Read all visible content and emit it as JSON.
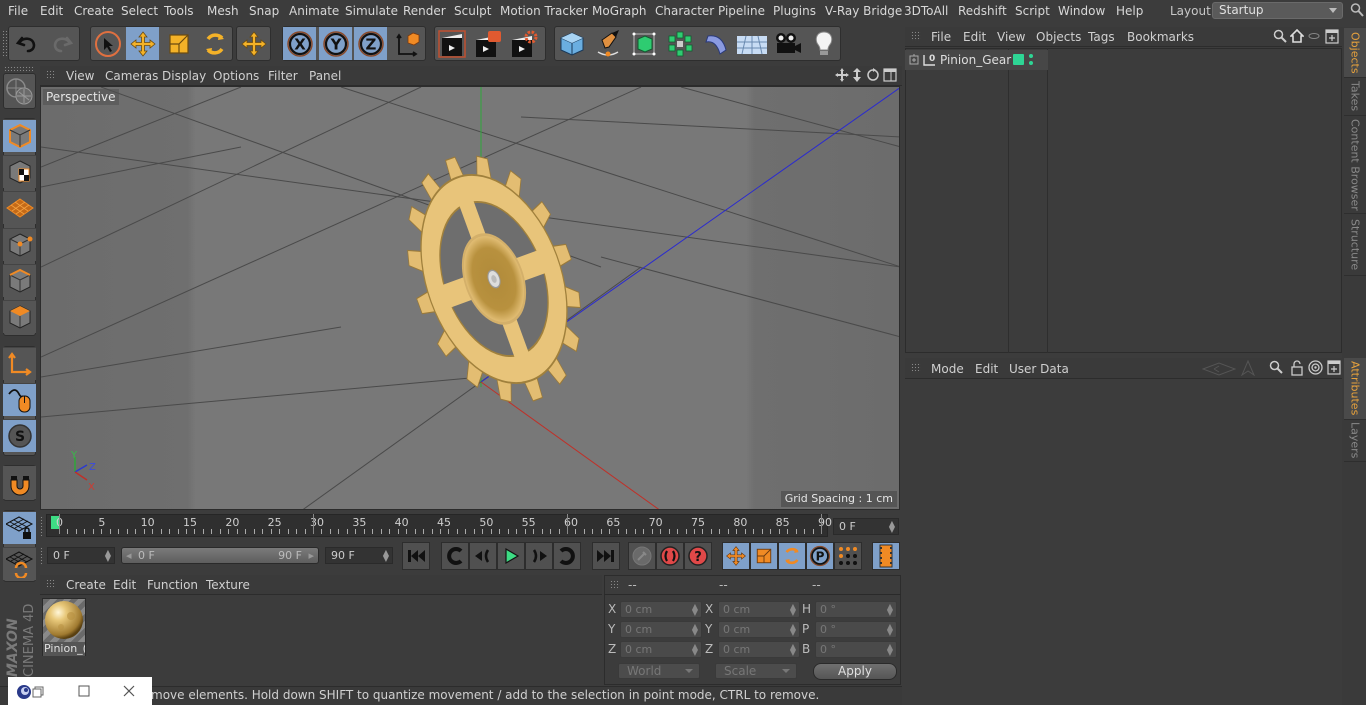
{
  "menubar": {
    "items": [
      "File",
      "Edit",
      "Create",
      "Select",
      "Tools",
      "Mesh",
      "Snap",
      "Animate",
      "Simulate",
      "Render",
      "Sculpt",
      "Motion Tracker",
      "MoGraph",
      "Character",
      "Pipeline",
      "Plugins",
      "V-Ray Bridge",
      "3DToAll",
      "Redshift",
      "Script",
      "Window",
      "Help"
    ],
    "layout_label": "Layout:",
    "layout_value": "Startup"
  },
  "toolbar": {
    "buttons": [
      "undo-icon",
      "redo-icon",
      "live-selection-icon",
      "move-icon",
      "scale-icon",
      "rotate-icon",
      "recent-tool-icon",
      "x-axis-icon",
      "y-axis-icon",
      "z-axis-icon",
      "coordinate-system-icon",
      "render-view-icon",
      "render-picture-viewer-icon",
      "render-settings-icon",
      "cube-icon",
      "pen-icon",
      "subdivision-icon",
      "cloner-icon",
      "deformer-icon",
      "floor-icon",
      "camera-icon",
      "light-icon"
    ]
  },
  "left_toolbar": {
    "buttons": [
      "make-editable-icon",
      "model-mode-icon",
      "texture-mode-icon",
      "workplane-mode-icon",
      "points-mode-icon",
      "edges-mode-icon",
      "polygons-mode-icon",
      "axis-mode-icon",
      "tweak-mode-icon",
      "solo-icon",
      "snap-icon",
      "workplane-lock-icon",
      "workplane-align-icon"
    ],
    "brand_line1": "MAXON",
    "brand_line2": "CINEMA 4D"
  },
  "viewport": {
    "menu": [
      "View",
      "Cameras",
      "Display",
      "Options",
      "Filter",
      "Panel"
    ],
    "camera_label": "Perspective",
    "grid_spacing": "Grid Spacing : 1 cm",
    "axis_labels": {
      "x": "X",
      "y": "Y",
      "z": "Z"
    },
    "colors": {
      "x_axis": "#c0392b",
      "y_axis": "#27ae3a",
      "z_axis": "#2b3bd0",
      "gear": "#e8c27a"
    }
  },
  "timeline": {
    "ticks": [
      "0",
      "5",
      "10",
      "15",
      "20",
      "25",
      "30",
      "35",
      "40",
      "45",
      "50",
      "55",
      "60",
      "65",
      "70",
      "75",
      "80",
      "85",
      "90"
    ],
    "current_frame_field": "0 F",
    "start_field": "0 F",
    "range_start": "0 F",
    "range_end": "90 F",
    "end_field": "90 F",
    "current_frame": 0,
    "max_frame": 90
  },
  "playback": {
    "buttons": [
      "go-to-start-icon",
      "previous-key-icon",
      "previous-frame-icon",
      "play-icon",
      "next-frame-icon",
      "next-key-icon",
      "go-to-end-icon",
      "record-disabled-icon",
      "autokey-icon",
      "keyframe-selection-icon",
      "key-position-icon",
      "key-scale-icon",
      "key-rotation-icon",
      "key-parameter-icon",
      "key-pla-icon",
      "timeline-icon"
    ]
  },
  "material_manager": {
    "menu": [
      "Create",
      "Edit",
      "Function",
      "Texture"
    ],
    "materials": [
      {
        "name": "Pinion_Gear",
        "display_name": "Pinion_("
      }
    ]
  },
  "coordinates": {
    "headers": [
      "--",
      "--",
      "--"
    ],
    "rows": [
      {
        "l1": "X",
        "v1": "0 cm",
        "l2": "X",
        "v2": "0 cm",
        "l3": "H",
        "v3": "0 °"
      },
      {
        "l1": "Y",
        "v1": "0 cm",
        "l2": "Y",
        "v2": "0 cm",
        "l3": "P",
        "v3": "0 °"
      },
      {
        "l1": "Z",
        "v1": "0 cm",
        "l2": "Z",
        "v2": "0 cm",
        "l3": "B",
        "v3": "0 °"
      }
    ],
    "mode_select": "World",
    "size_select": "Scale",
    "apply_label": "Apply"
  },
  "status": {
    "text": "move elements. Hold down SHIFT to quantize movement / add to the selection in point mode, CTRL to remove."
  },
  "object_manager": {
    "menu": [
      "File",
      "Edit",
      "View",
      "Objects",
      "Tags",
      "Bookmarks"
    ],
    "objects": [
      {
        "name": "Pinion_Gear",
        "tag_color": "#2ed695"
      }
    ]
  },
  "attribute_manager": {
    "menu": [
      "Mode",
      "Edit",
      "User Data"
    ]
  },
  "right_tabs": {
    "top": [
      {
        "label": "Objects",
        "active": true
      },
      {
        "label": "Takes",
        "active": false
      },
      {
        "label": "Content Browser",
        "active": false
      },
      {
        "label": "Structure",
        "active": false
      }
    ],
    "bottom": [
      {
        "label": "Attributes",
        "active": true
      },
      {
        "label": "Layers",
        "active": false
      }
    ]
  }
}
